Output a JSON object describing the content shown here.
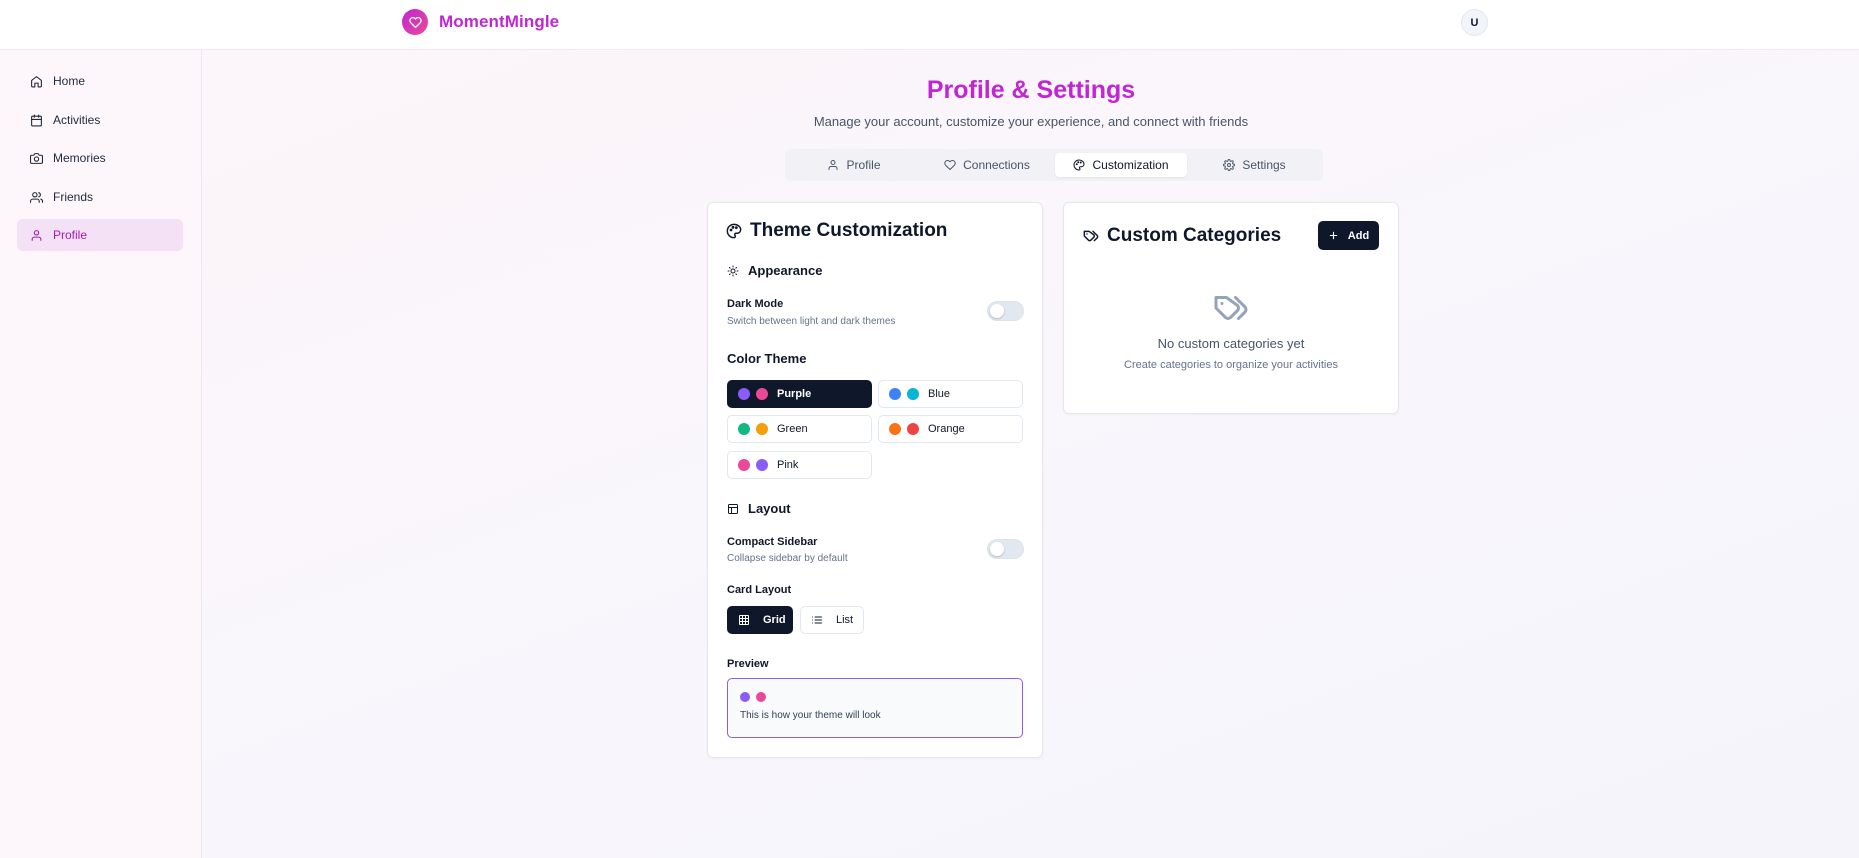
{
  "app": {
    "name": "MomentMingle",
    "avatar_initial": "U",
    "brand_gradient": [
      "#c026d3",
      "#ec4899"
    ]
  },
  "sidebar": {
    "items": [
      {
        "label": "Home",
        "icon": "home-icon",
        "active": false
      },
      {
        "label": "Activities",
        "icon": "calendar-icon",
        "active": false
      },
      {
        "label": "Memories",
        "icon": "camera-icon",
        "active": false
      },
      {
        "label": "Friends",
        "icon": "users-icon",
        "active": false
      },
      {
        "label": "Profile",
        "icon": "user-icon",
        "active": true
      }
    ]
  },
  "page": {
    "title": "Profile & Settings",
    "subtitle": "Manage your account, customize your experience, and connect with friends"
  },
  "tabs": [
    {
      "label": "Profile",
      "icon": "user-icon",
      "active": false
    },
    {
      "label": "Connections",
      "icon": "heart-icon",
      "active": false
    },
    {
      "label": "Customization",
      "icon": "palette-icon",
      "active": true
    },
    {
      "label": "Settings",
      "icon": "gear-icon",
      "active": false
    }
  ],
  "theme_card": {
    "title": "Theme Customization",
    "appearance": {
      "heading": "Appearance",
      "dark_mode_label": "Dark Mode",
      "dark_mode_desc": "Switch between light and dark themes",
      "dark_mode_on": false
    },
    "color_theme": {
      "heading": "Color Theme",
      "options": [
        {
          "label": "Purple",
          "colors": [
            "#8b5cf6",
            "#ec4899"
          ],
          "selected": true
        },
        {
          "label": "Blue",
          "colors": [
            "#3b82f6",
            "#06b6d4"
          ],
          "selected": false
        },
        {
          "label": "Green",
          "colors": [
            "#10b981",
            "#f59e0b"
          ],
          "selected": false
        },
        {
          "label": "Orange",
          "colors": [
            "#f97316",
            "#ef4444"
          ],
          "selected": false
        },
        {
          "label": "Pink",
          "colors": [
            "#ec4899",
            "#8b5cf6"
          ],
          "selected": false
        }
      ]
    },
    "layout": {
      "heading": "Layout",
      "compact_label": "Compact Sidebar",
      "compact_desc": "Collapse sidebar by default",
      "compact_on": false,
      "card_layout_label": "Card Layout",
      "grid_label": "Grid",
      "list_label": "List",
      "selected": "Grid"
    },
    "preview": {
      "label": "Preview",
      "text": "This is how your theme will look",
      "colors": [
        "#8b5cf6",
        "#ec4899"
      ],
      "border_color": "#8b5cf6"
    }
  },
  "categories_card": {
    "title": "Custom Categories",
    "add_label": "Add",
    "empty_title": "No custom categories yet",
    "empty_desc": "Create categories to organize your activities"
  },
  "colors": {
    "accent": "#c026d3",
    "dark": "#0f172a",
    "active_nav_bg": "#f5e1f5"
  }
}
